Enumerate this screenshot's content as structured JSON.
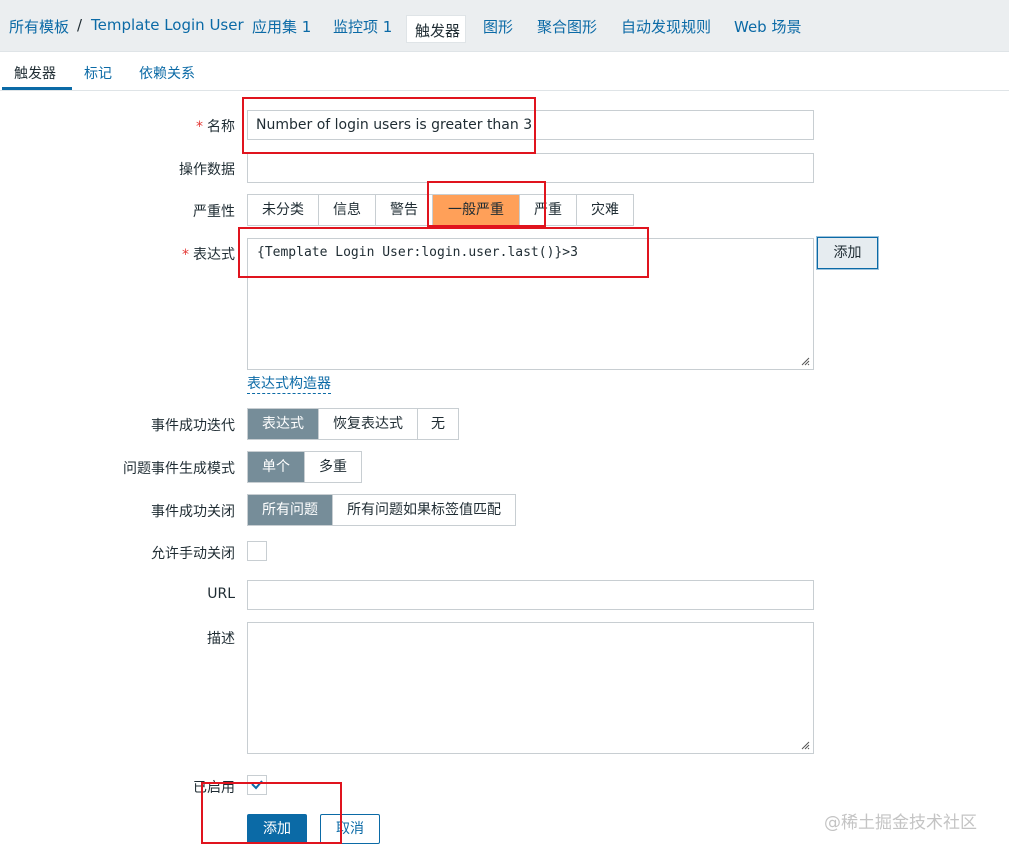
{
  "breadcrumb": {
    "all_templates": "所有模板",
    "separator": "/",
    "template": "Template Login User",
    "applications": "应用集 1",
    "items": "监控项 1",
    "triggers": "触发器",
    "graphs": "图形",
    "screens": "聚合图形",
    "discovery": "自动发现规则",
    "web": "Web 场景"
  },
  "tabs": {
    "trigger": "触发器",
    "tags": "标记",
    "dependencies": "依赖关系"
  },
  "form": {
    "name_label": "名称",
    "name_value": "Number of login users is greater than 3",
    "opdata_label": "操作数据",
    "opdata_value": "",
    "severity_label": "严重性",
    "severity_options": [
      "未分类",
      "信息",
      "警告",
      "一般严重",
      "严重",
      "灾难"
    ],
    "severity_selected": "一般严重",
    "expression_label": "表达式",
    "expression_value": "{Template Login User:login.user.last()}>3",
    "expression_add_button": "添加",
    "expression_constructor_link": "表达式构造器",
    "ok_event_gen_label": "事件成功迭代",
    "ok_event_gen_options": [
      "表达式",
      "恢复表达式",
      "无"
    ],
    "ok_event_gen_selected": "表达式",
    "problem_mode_label": "问题事件生成模式",
    "problem_mode_options": [
      "单个",
      "多重"
    ],
    "problem_mode_selected": "单个",
    "ok_close_label": "事件成功关闭",
    "ok_close_options": [
      "所有问题",
      "所有问题如果标签值匹配"
    ],
    "ok_close_selected": "所有问题",
    "manual_close_label": "允许手动关闭",
    "manual_close_checked": false,
    "url_label": "URL",
    "url_value": "",
    "description_label": "描述",
    "description_value": "",
    "enabled_label": "已启用",
    "enabled_checked": true,
    "add_button": "添加",
    "cancel_button": "取消"
  },
  "colors": {
    "link": "#0b6aa6",
    "required": "#e33734",
    "severity_average": "#ffa059",
    "segment_selected": "#768d99",
    "annotation": "#e0141e"
  },
  "watermark": "@稀土掘金技术社区"
}
